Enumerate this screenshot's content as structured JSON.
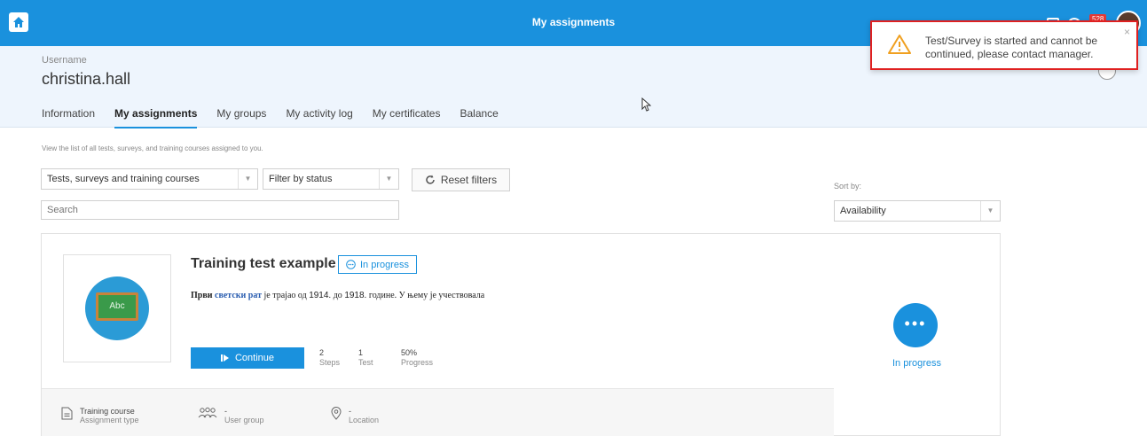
{
  "topbar": {
    "title": "My assignments",
    "badge": "528"
  },
  "profile": {
    "username_label": "Username",
    "username": "christina.hall",
    "tabs": [
      {
        "label": "Information"
      },
      {
        "label": "My assignments"
      },
      {
        "label": "My groups"
      },
      {
        "label": "My activity log"
      },
      {
        "label": "My certificates"
      },
      {
        "label": "Balance"
      }
    ]
  },
  "filters": {
    "hint": "View the list of all tests, surveys, and training courses assigned to you.",
    "type_filter": "Tests, surveys and training courses",
    "status_filter": "Filter by status",
    "reset_label": "Reset filters",
    "search_placeholder": "Search",
    "sort_label": "Sort by:",
    "sort_value": "Availability"
  },
  "card": {
    "thumb_text": "Abc",
    "title": "Training test example",
    "status": "In progress",
    "desc_bold": "Први",
    "desc_link": "светски рат",
    "desc_rest_1": "је трајао од",
    "desc_num_1": "1914.",
    "desc_rest_2": "до",
    "desc_num_2": "1918.",
    "desc_rest_3": "године. У њему је учествовала",
    "continue_label": "Continue",
    "stats": [
      {
        "value": "2",
        "label": "Steps"
      },
      {
        "value": "1",
        "label": "Test"
      },
      {
        "value": "50%",
        "label": "Progress"
      }
    ],
    "footer": {
      "assignment_type_value": "Training course",
      "assignment_type_label": "Assignment type",
      "user_group_value": "-",
      "user_group_label": "User group",
      "location_value": "-",
      "location_label": "Location"
    },
    "side_status": "In progress"
  },
  "toast": {
    "message": "Test/Survey is started and cannot be continued, please contact manager.",
    "close": "×"
  },
  "colors": {
    "accent": "#1a91dd",
    "alert_border": "#e02020",
    "warning": "#f0a020"
  }
}
